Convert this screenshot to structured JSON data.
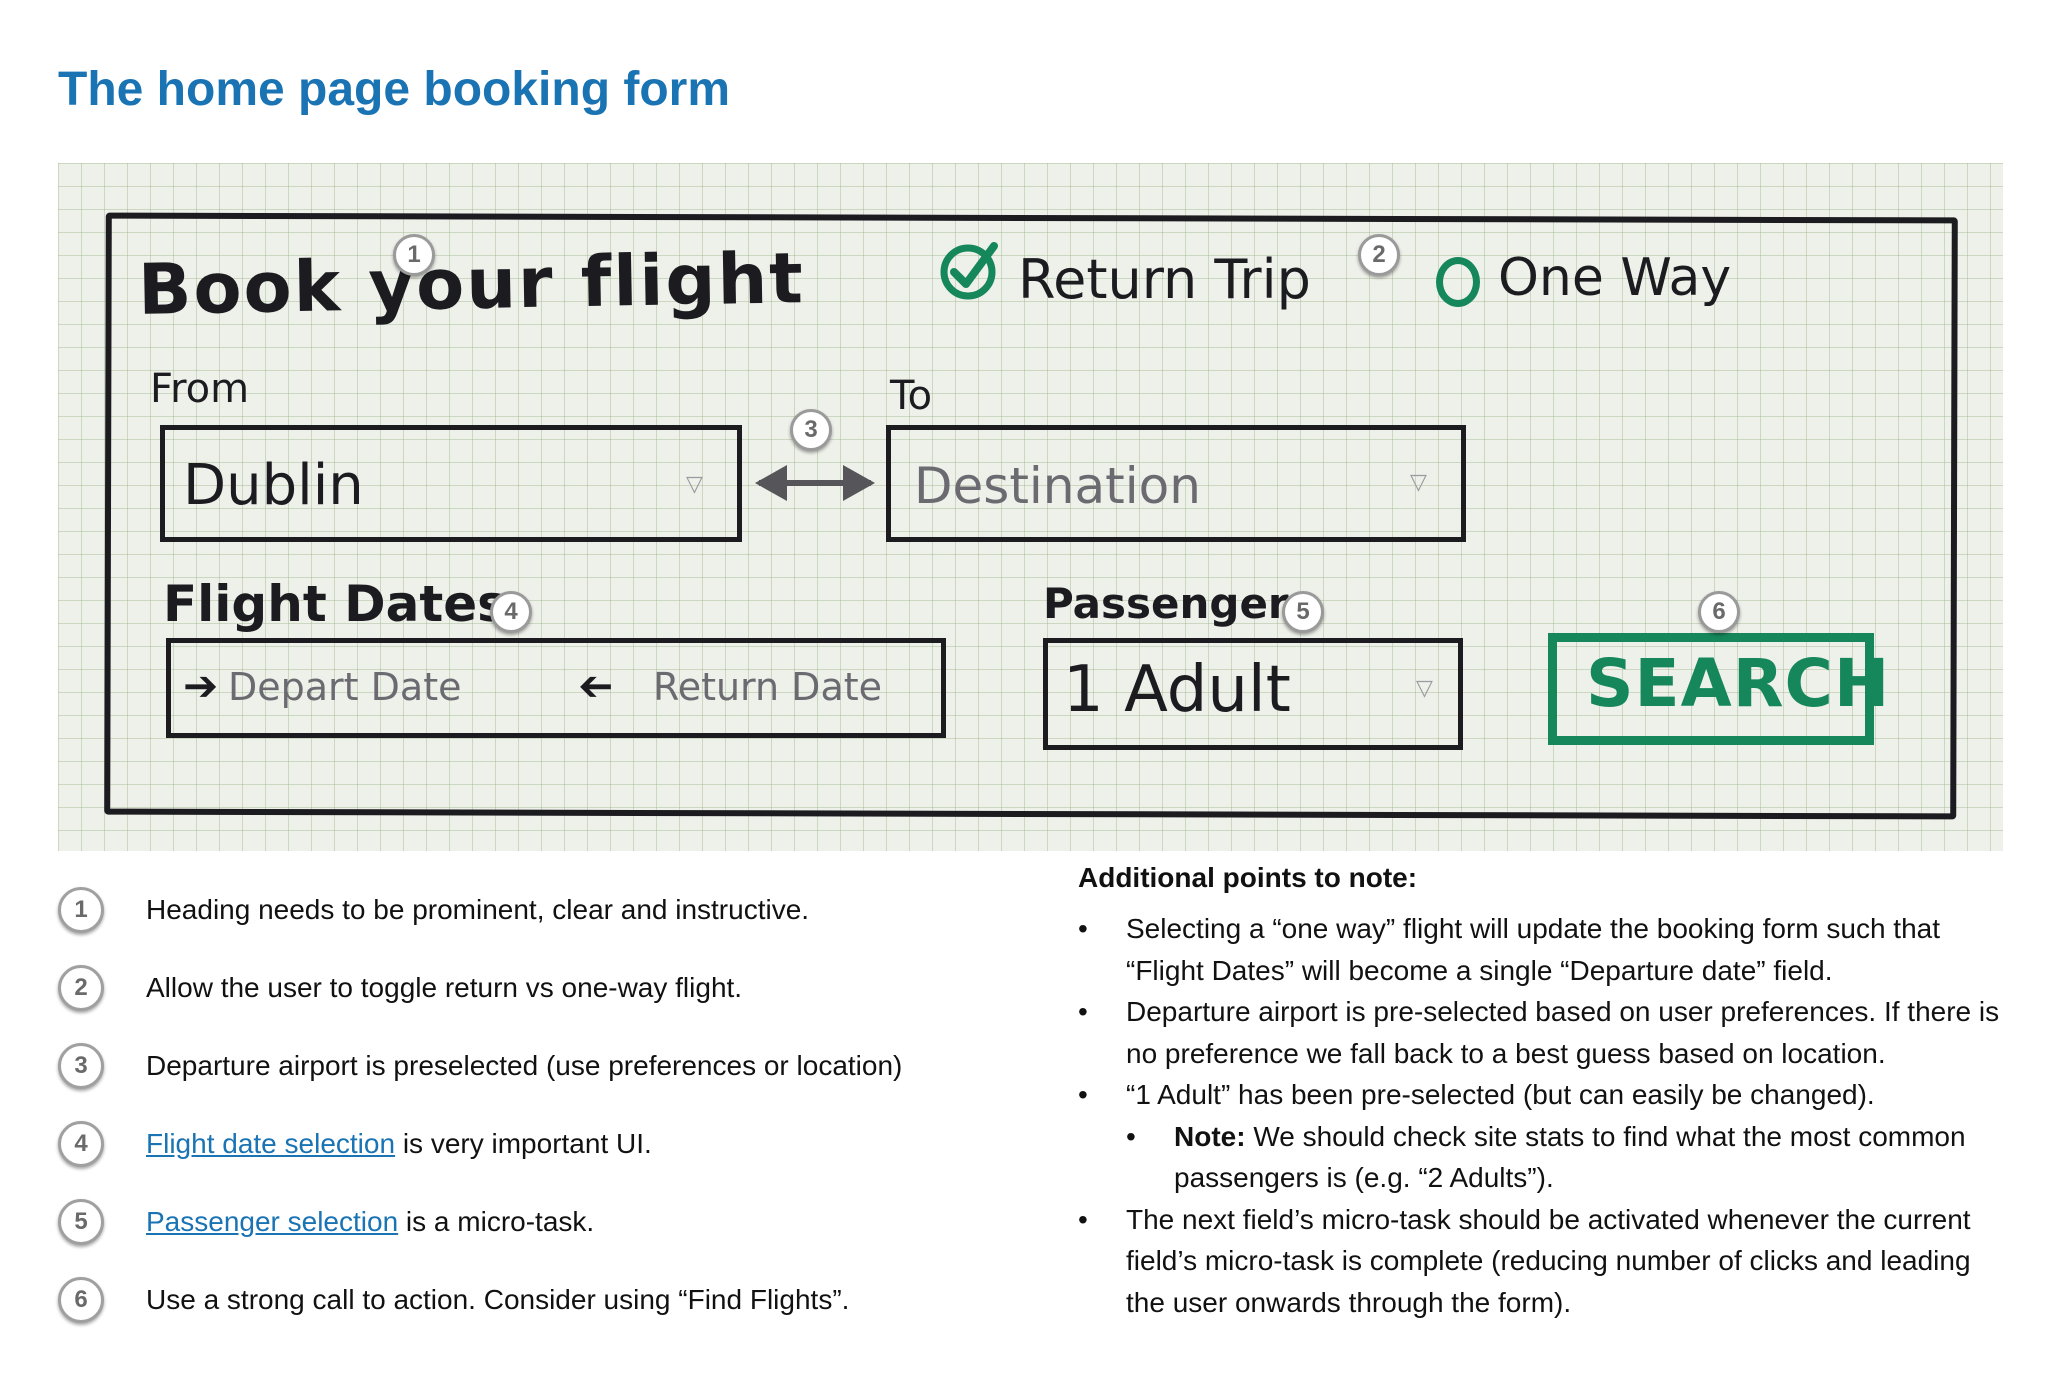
{
  "page_title": "The home page booking form",
  "sketch": {
    "heading": "Book your flight",
    "return_trip": "Return Trip",
    "one_way": "One Way",
    "from_label": "From",
    "from_value": "Dublin",
    "to_label": "To",
    "to_placeholder": "Destination",
    "dates_label": "Flight Dates",
    "depart_placeholder": "Depart Date",
    "return_placeholder": "Return Date",
    "passengers_label": "Passengers",
    "passengers_value": "1 Adult",
    "search_label": "SEARCH",
    "markers": [
      "1",
      "2",
      "3",
      "4",
      "5",
      "6"
    ],
    "colors": {
      "ink": "#1b1b20",
      "green": "#15875a",
      "paper": "#eef0ea"
    }
  },
  "notes": [
    {
      "num": "1",
      "link": "",
      "text": "Heading needs to be prominent, clear and instructive."
    },
    {
      "num": "2",
      "link": "",
      "text": "Allow the user to toggle return vs one-way flight."
    },
    {
      "num": "3",
      "link": "",
      "text": "Departure airport is preselected (use preferences or location)"
    },
    {
      "num": "4",
      "link": "Flight date selection",
      "text": " is very important UI."
    },
    {
      "num": "5",
      "link": "Passenger selection",
      "text": " is a micro-task."
    },
    {
      "num": "6",
      "link": "",
      "text": "Use a strong call to action. Consider using “Find Flights”."
    }
  ],
  "additional": {
    "heading": "Additional points to note:",
    "points": [
      "Selecting a “one way” flight will update the booking form such that “Flight Dates” will become a single “Departure date” field.",
      "Departure airport is pre-selected based on user preferences. If there is no preference we fall back to a best guess based on location.",
      "“1 Adult” has been pre-selected (but can easily be changed).",
      "The next field’s micro-task should be activated whenever the current field’s micro-task is complete (reducing number of clicks and leading the user onwards through the form)."
    ],
    "sub_note_label": "Note:",
    "sub_note_text": " We should check site stats to find what the most common passengers is (e.g. “2 Adults”)."
  },
  "link_color": "#1a73b3",
  "title_color": "#1a73b3"
}
